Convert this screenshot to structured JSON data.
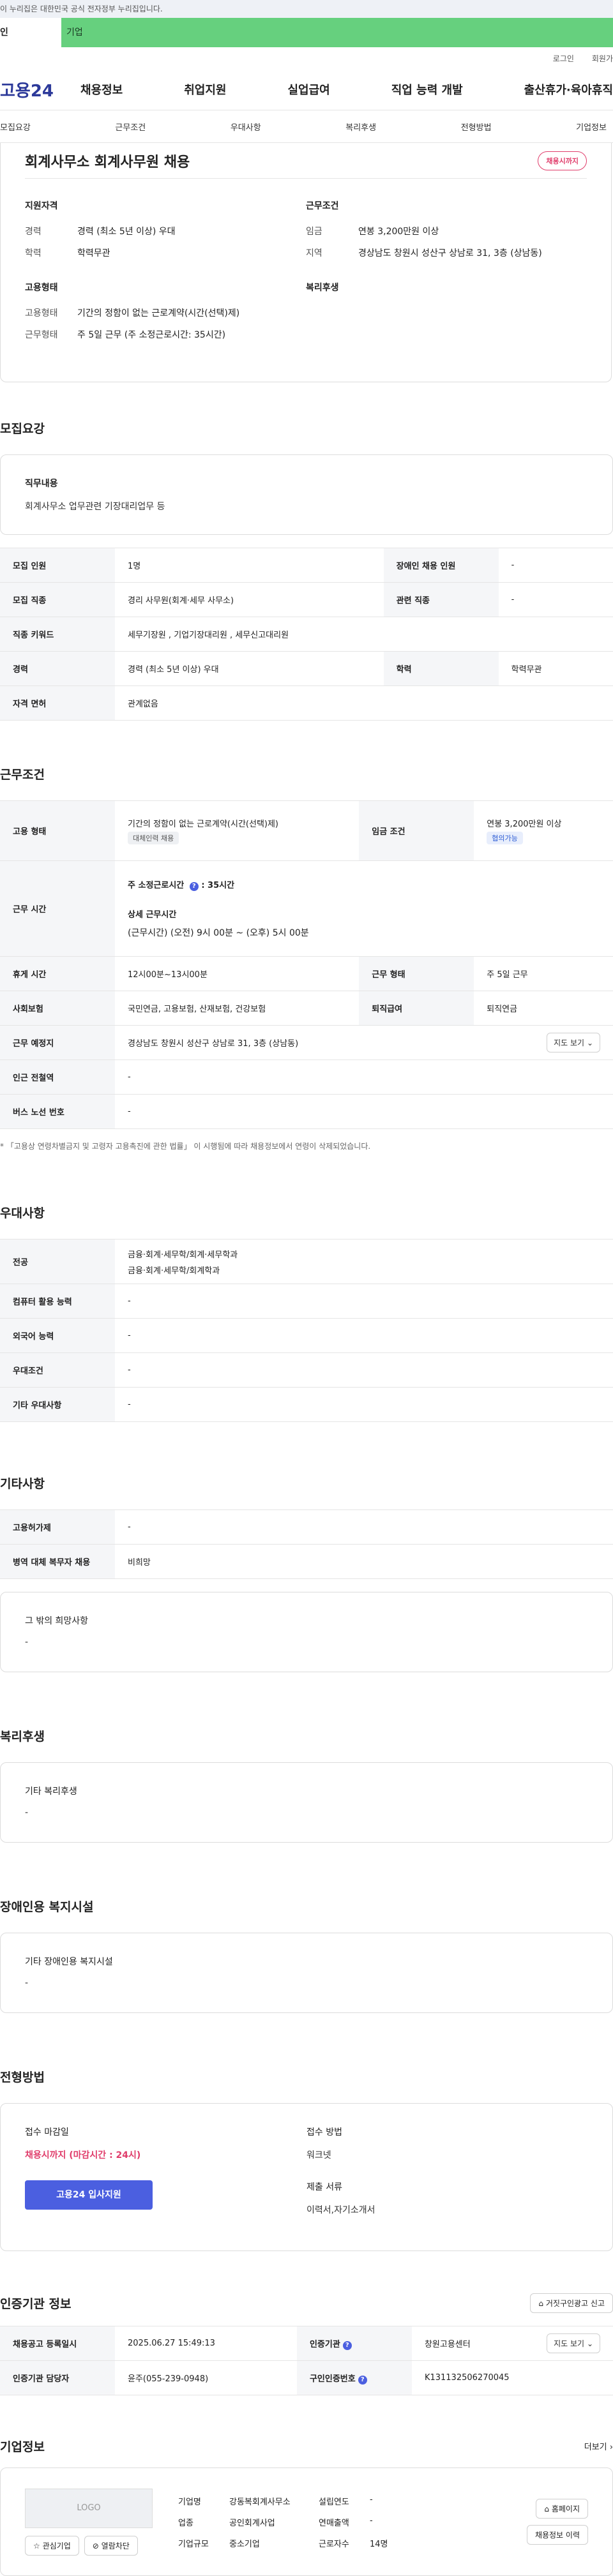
{
  "gov_strip": "이 누리집은 대한민국 공식 전자정부 누리집입니다.",
  "tabs": {
    "a": "인",
    "b": "기업"
  },
  "util": {
    "login": "로그인",
    "join": "회원가"
  },
  "logo": "고용24",
  "gnb": [
    "채용정보",
    "취업지원",
    "실업급여",
    "직업 능력 개발",
    "출산휴가·육아휴직"
  ],
  "anchors": [
    "모집요강",
    "근무조건",
    "우대사항",
    "복리후생",
    "전형방법",
    "기업정보"
  ],
  "job": {
    "title": "회계사무소 회계사무원 채용",
    "status_pill": "채용시까지",
    "left_h1": "지원자격",
    "left_kv": [
      {
        "k": "경력",
        "v": "경력 (최소 5년 이상) 우대"
      },
      {
        "k": "학력",
        "v": "학력무관"
      }
    ],
    "left_h2": "고용형태",
    "left_kv2": [
      {
        "k": "고용형태",
        "v": "기간의 정함이 없는 근로계약(시간(선택)제)"
      },
      {
        "k": "근무형태",
        "v": "주 5일 근무 (주 소정근로시간: 35시간)"
      }
    ],
    "right_h1": "근무조건",
    "right_kv": [
      {
        "k": "임금",
        "v": "연봉 3,200만원 이상"
      },
      {
        "k": "지역",
        "v": "경상남도 창원시 성산구 상남로 31, 3층 (상남동)"
      }
    ],
    "right_h2": "복리후생"
  },
  "recruit": {
    "title": "모집요강",
    "duty_h": "직무내용",
    "duty": "회계사무소 업무관련 기장대리업무 등",
    "rows": [
      {
        "k1": "모집 인원",
        "v1": "1명",
        "k2": "장애인 채용 인원",
        "v2": "-"
      },
      {
        "k1": "모집 직종",
        "v1": "경리 사무원(회계·세무 사무소)",
        "k2": "관련 직종",
        "v2": "-"
      },
      {
        "k1": "직종 키워드",
        "v1": "세무기장원 , 기업기장대리원 , 세무신고대리원"
      },
      {
        "k1": "경력",
        "v1": "경력 (최소 5년 이상) 우대",
        "k2": "학력",
        "v2": "학력무관"
      },
      {
        "k1": "자격 면허",
        "v1": "관계없음"
      }
    ]
  },
  "cond": {
    "title": "근무조건",
    "emp_type_k": "고용 형태",
    "emp_type_v": "기간의 정함이 없는 근로계약(시간(선택)제)",
    "emp_tag": "대체인력 채용",
    "wage_k": "임금 조건",
    "wage_v": "연봉 3,200만원 이상",
    "wage_tag": "협의가능",
    "hours_k": "근무 시간",
    "hours_week": "주 소정근로시간",
    "hours_week_v": ": 35시간",
    "hours_detail_h": "상세 근무시간",
    "hours_detail": "(근무시간) (오전) 9시 00분 ~ (오후) 5시 00분",
    "rest_k": "휴게 시간",
    "rest_v": "12시00분~13시00분",
    "form_k": "근무 형태",
    "form_v": "주 5일 근무",
    "ins_k": "사회보험",
    "ins_v": "국민연금, 고용보험, 산재보험, 건강보험",
    "ret_k": "퇴직급여",
    "ret_v": "퇴직연금",
    "place_k": "근무 예정지",
    "place_v": "경상남도 창원시 성산구 상남로 31, 3층 (상남동)",
    "map_btn": "지도 보기",
    "subway_k": "인근 전철역",
    "subway_v": "-",
    "bus_k": "버스 노선 번호",
    "bus_v": "-",
    "note": "* 「고용상 연령차별금지 및 고령자 고용촉진에 관한 법률」 이 시행됨에 따라 채용정보에서 연령이 삭제되었습니다."
  },
  "pref": {
    "title": "우대사항",
    "rows": [
      {
        "k": "전공",
        "v": "금융·회계·세무학/회계·세무학과",
        "v2": "금융·회계·세무학/회계학과"
      },
      {
        "k": "컴퓨터 활용 능력",
        "v": "-"
      },
      {
        "k": "외국어 능력",
        "v": "-"
      },
      {
        "k": "우대조건",
        "v": "-"
      },
      {
        "k": "기타 우대사항",
        "v": "-"
      }
    ]
  },
  "etc": {
    "title": "기타사항",
    "rows": [
      {
        "k": "고용허가제",
        "v": "-"
      },
      {
        "k": "병역 대체 복무자 채용",
        "v": "비희망"
      }
    ],
    "box_h": "그 밖의 희망사항",
    "box_v": "-"
  },
  "welfare": {
    "title": "복리후생",
    "box_h": "기타 복리후생",
    "box_v": "-"
  },
  "disabled": {
    "title": "장애인용 복지시설",
    "box_h": "기타 장애인용 복지시설",
    "box_v": "-"
  },
  "proc": {
    "title": "전형방법",
    "deadline_h": "접수 마감일",
    "deadline_v": "채용시까지 (마감시간 : 24시)",
    "apply_btn": "고용24 입사지원",
    "method_h": "접수 방법",
    "method_v": "워크넷",
    "docs_h": "제출 서류",
    "docs_v": "이력서,자기소개서"
  },
  "cert": {
    "title": "인증기관 정보",
    "report_btn": "거짓구인광고 신고",
    "rows": [
      {
        "k1": "채용공고 등록일시",
        "v1": "2025.06.27 15:49:13",
        "k2": "인증기관",
        "v2": "창원고용센터"
      },
      {
        "k1": "인증기관 담당자",
        "v1": "윤주(055-239-0948)",
        "k2": "구인인증번호",
        "v2": "K131132506270045"
      }
    ],
    "map_btn": "지도 보기"
  },
  "company": {
    "title": "기업정보",
    "more": "더보기",
    "logo": "LOGO",
    "btn_fav": "관심기업",
    "btn_block": "열람차단",
    "fields": [
      {
        "k": "기업명",
        "v": "강동복회계사무소",
        "k2": "설립연도",
        "v2": "-"
      },
      {
        "k": "업종",
        "v": "공인회계사업",
        "k2": "연매출액",
        "v2": "-"
      },
      {
        "k": "기업규모",
        "v": "중소기업",
        "k2": "근로자수",
        "v2": "14명"
      }
    ],
    "btn_home": "홈페이지",
    "btn_history": "채용정보 이력"
  }
}
